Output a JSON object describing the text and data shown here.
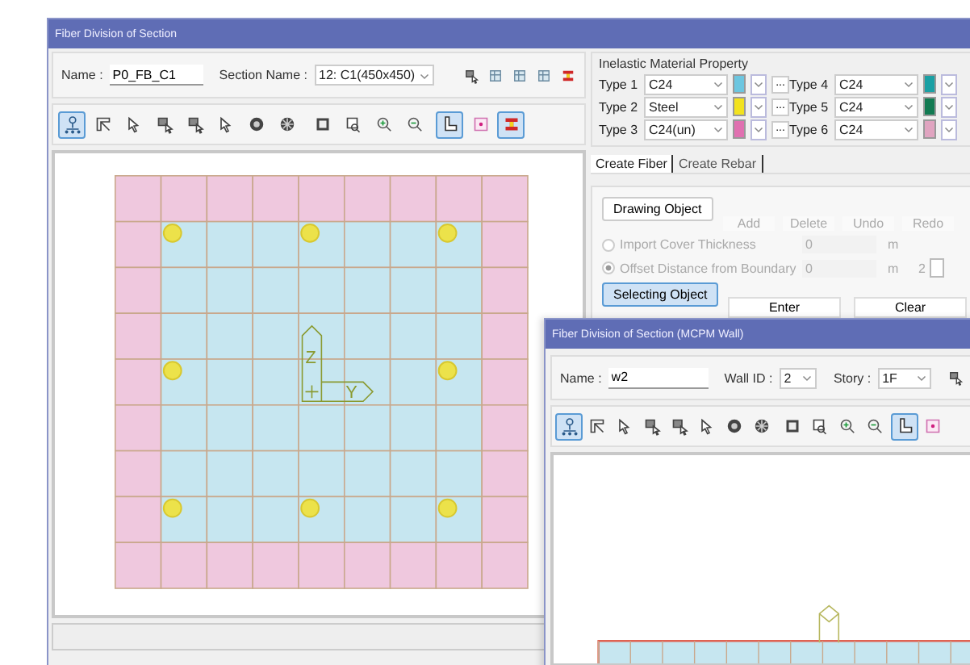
{
  "main_window": {
    "title": "Fiber Division of Section",
    "name_label": "Name :",
    "name_value": "P0_FB_C1",
    "section_label": "Section Name :",
    "section_value": "12: C1(450x450)",
    "header_tools": [
      {
        "kind": "move"
      },
      {
        "kind": "table"
      },
      {
        "kind": "table"
      },
      {
        "kind": "table"
      },
      {
        "kind": "beam"
      }
    ],
    "toolbar": [
      {
        "kind": "node",
        "selected": true
      },
      {
        "kind": "frame",
        "selected": false
      },
      {
        "kind": "cursor",
        "selected": false
      },
      {
        "kind": "move",
        "selected": false
      },
      {
        "kind": "move",
        "selected": false
      },
      {
        "kind": "cursor",
        "selected": false
      },
      {
        "kind": "circle",
        "selected": false
      },
      {
        "kind": "wheel",
        "selected": false
      },
      {
        "kind": "square",
        "selected": false
      },
      {
        "kind": "window",
        "selected": false
      },
      {
        "kind": "zoom-in",
        "selected": false
      },
      {
        "kind": "zoom-out",
        "selected": false
      },
      {
        "kind": "axis",
        "selected": true
      },
      {
        "kind": "point",
        "selected": false
      },
      {
        "kind": "beam",
        "selected": true
      }
    ],
    "axis_labels": [
      "Z",
      "Y"
    ]
  },
  "material": {
    "title": "Inelastic Material Property",
    "types": [
      {
        "label": "Type 1",
        "value": "C24",
        "color": "#6cc6e0",
        "button": "..."
      },
      {
        "label": "Type 2",
        "value": "Steel",
        "color": "#f2e21e",
        "button": "..."
      },
      {
        "label": "Type 3",
        "value": "C24(un)",
        "color": "#e070b0",
        "button": "..."
      },
      {
        "label": "Type 4",
        "value": "C24",
        "color": "#1aa0a4"
      },
      {
        "label": "Type 5",
        "value": "C24",
        "color": "#127a52"
      },
      {
        "label": "Type 6",
        "value": "C24",
        "color": "#e0a4c0"
      }
    ]
  },
  "tabs": [
    {
      "label": "Create Fiber",
      "selected": true
    },
    {
      "label": "Create Rebar",
      "selected": false
    }
  ],
  "drawing_object": {
    "label": "Drawing Object",
    "selected": false
  },
  "actions": [
    {
      "label": "Add",
      "disabled": true
    },
    {
      "label": "Delete",
      "disabled": true
    },
    {
      "label": "Undo",
      "disabled": true
    },
    {
      "label": "Redo",
      "disabled": true
    }
  ],
  "options": [
    {
      "label": "Import Cover Thickness",
      "selected": false,
      "disabled": true,
      "value": "0",
      "unit": "m"
    },
    {
      "label": "Offset Distance from Boundary",
      "selected": true,
      "disabled": true,
      "value": "0",
      "unit": "m",
      "count": "2"
    }
  ],
  "selecting_object": {
    "label": "Selecting Object",
    "selected": true
  },
  "enter": "Enter",
  "clear": "Clear",
  "wall_window": {
    "title": "Fiber Division of Section (MCPM Wall)",
    "name_label": "Name :",
    "name_value": "w2",
    "wall_label": "Wall ID :",
    "wall_value": "2",
    "story_label": "Story :",
    "story_value": "1F",
    "header_tools": [
      {
        "kind": "move"
      }
    ],
    "toolbar": [
      {
        "kind": "node",
        "selected": true
      },
      {
        "kind": "frame",
        "selected": false
      },
      {
        "kind": "cursor",
        "selected": false
      },
      {
        "kind": "move",
        "selected": false
      },
      {
        "kind": "move",
        "selected": false
      },
      {
        "kind": "cursor",
        "selected": false
      },
      {
        "kind": "circle",
        "selected": false
      },
      {
        "kind": "wheel",
        "selected": false
      },
      {
        "kind": "square",
        "selected": false
      },
      {
        "kind": "window",
        "selected": false
      },
      {
        "kind": "zoom-in",
        "selected": false
      },
      {
        "kind": "zoom-out",
        "selected": false
      },
      {
        "kind": "axis",
        "selected": true
      },
      {
        "kind": "point",
        "selected": false
      }
    ]
  }
}
